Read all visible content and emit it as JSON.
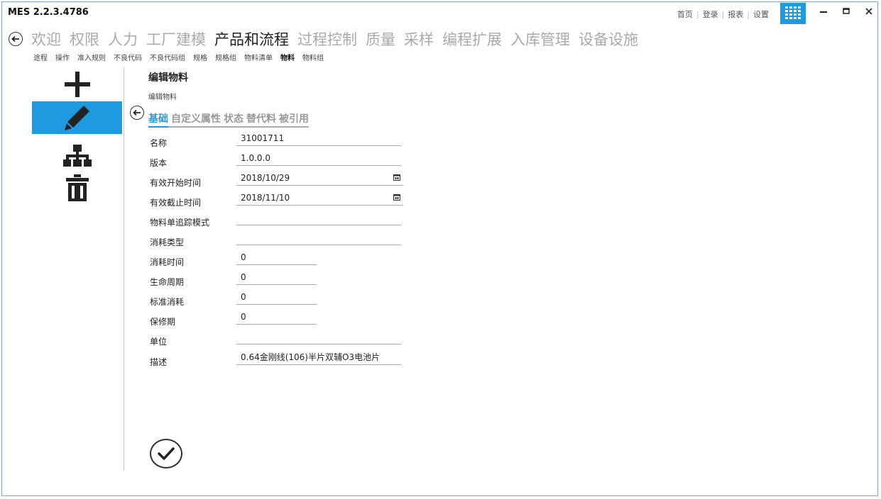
{
  "app": {
    "title": "MES 2.2.3.4786"
  },
  "top_links": [
    "首页",
    "登录",
    "报表",
    "设置"
  ],
  "window_controls": {
    "minimize": "–",
    "maximize": "□",
    "close": "✕"
  },
  "main_nav": {
    "items": [
      "欢迎",
      "权限",
      "人力",
      "工厂建模",
      "产品和流程",
      "过程控制",
      "质量",
      "采样",
      "编程扩展",
      "入库管理",
      "设备设施"
    ],
    "active": "产品和流程"
  },
  "sub_nav": {
    "items": [
      "途程",
      "操作",
      "准入规则",
      "不良代码",
      "不良代码组",
      "规格",
      "规格组",
      "物料清单",
      "物料",
      "物料组"
    ],
    "active": "物料"
  },
  "sidebar": {
    "icons": [
      "add-icon",
      "edit-icon",
      "hierarchy-icon",
      "delete-icon"
    ],
    "active": "edit-icon"
  },
  "page": {
    "title": "编辑物料",
    "subtitle": "编辑物料",
    "tabs": [
      "基础",
      "自定义属性",
      "状态",
      "替代料",
      "被引用"
    ],
    "active_tab": "基础"
  },
  "form": {
    "name_label": "名称",
    "name_value": "31001711",
    "version_label": "版本",
    "version_value": "1.0.0.0",
    "start_label": "有效开始时间",
    "start_value": "2018/10/29",
    "end_label": "有效截止时间",
    "end_value": "2018/11/10",
    "tracking_label": "物料单追踪模式",
    "tracking_value": "",
    "consume_type_label": "消耗类型",
    "consume_type_value": "",
    "consume_time_label": "消耗时间",
    "consume_time_value": "0",
    "lifecycle_label": "生命周期",
    "lifecycle_value": "0",
    "std_consume_label": "标准消耗",
    "std_consume_value": "0",
    "warranty_label": "保修期",
    "warranty_value": "0",
    "unit_label": "单位",
    "unit_value": "",
    "desc_label": "描述",
    "desc_value": "0.64金刚线(106)半片双辅O3电池片"
  },
  "colors": {
    "accent": "#1e9be0",
    "frame": "#7fa9c9"
  }
}
